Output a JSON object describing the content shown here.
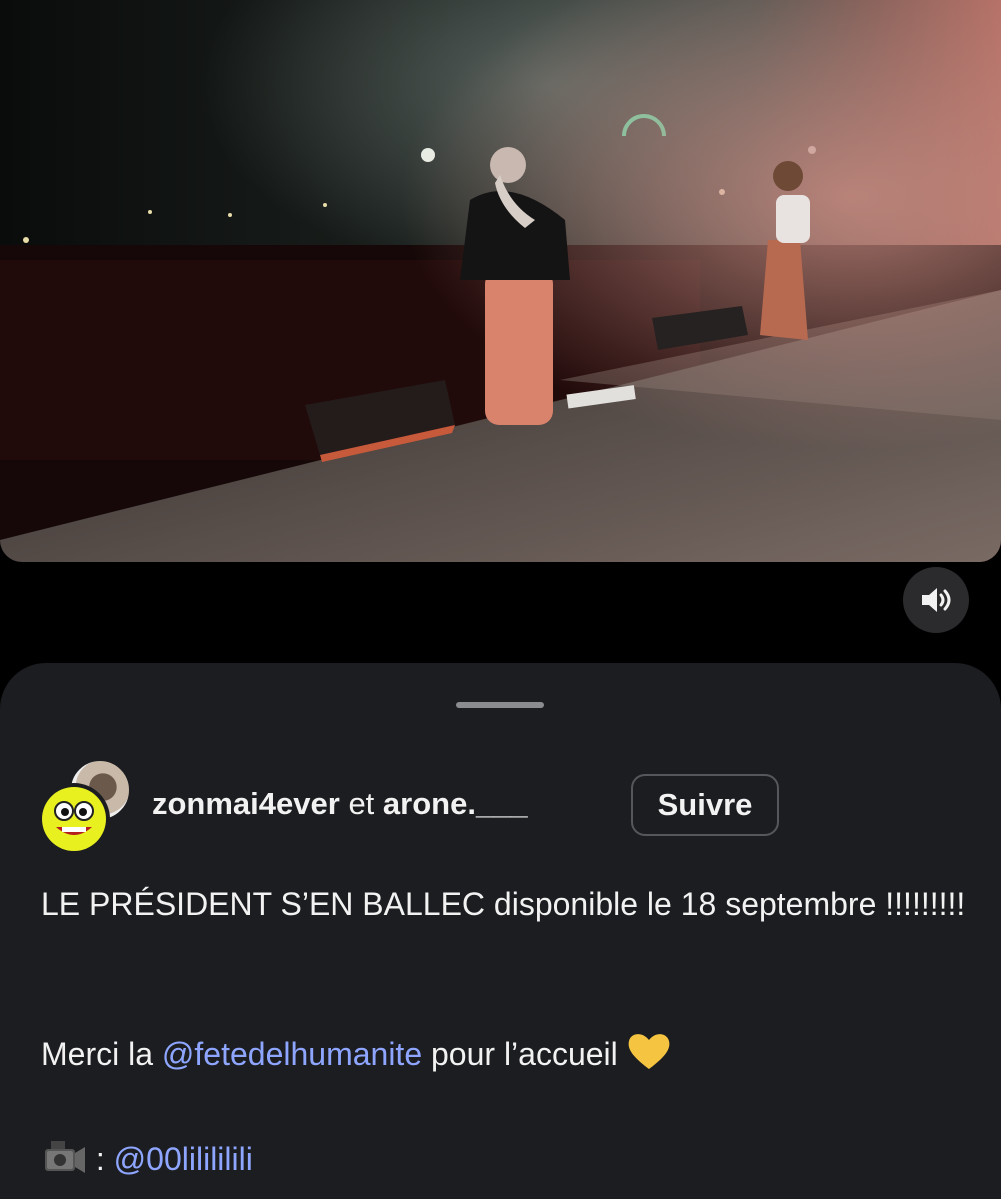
{
  "video": {
    "sound_icon": "speaker-icon"
  },
  "post": {
    "author1": "zonmai4ever",
    "joiner": " et ",
    "author2": "arone.___",
    "follow_label": "Suivre",
    "caption_line1": "LE PRÉSIDENT S’EN BALLEC disponible le 18 septembre !!!!!!!!!",
    "merci_prefix": "Merci la ",
    "merci_mention": "@fetedelhumanite",
    "merci_suffix": " pour l’accueil ",
    "heart_emoji": "💛",
    "camera_emoji": "📹",
    "credit_sep": " : ",
    "credit_mention": "@00lilililili"
  },
  "colors": {
    "mention": "#8ea6ff",
    "sheet": "#1c1d20",
    "heart": "#f5c542"
  }
}
